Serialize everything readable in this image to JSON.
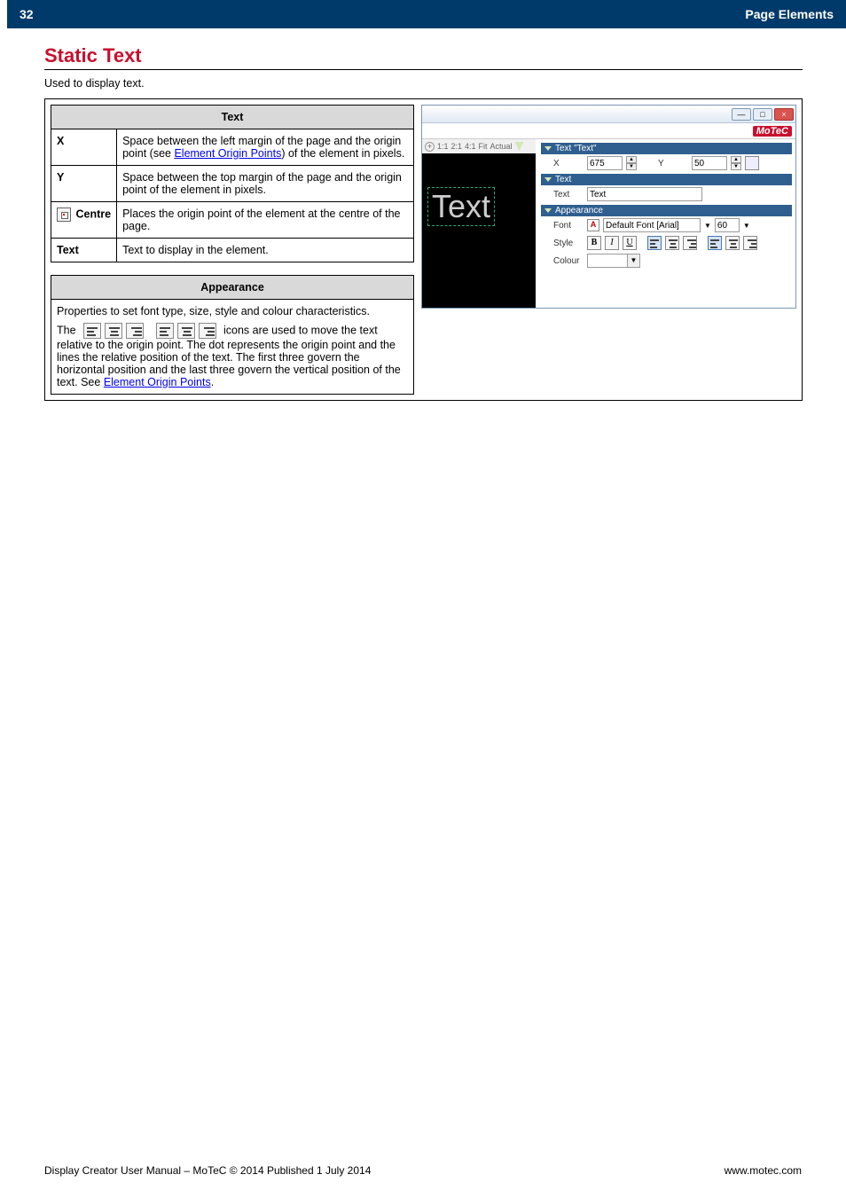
{
  "header": {
    "page_number": "32",
    "section": "Page Elements"
  },
  "section_title": "Static Text",
  "intro": "Used to display text.",
  "text_table": {
    "heading": "Text",
    "rows": [
      {
        "key": "X",
        "desc_a": "Space between the left margin of the page and the origin point (see ",
        "link": "Element Origin Points",
        "desc_b": ") of the element in pixels."
      },
      {
        "key": "Y",
        "desc_a": "Space between the top margin of the page and the origin point of the element in pixels.",
        "link": "",
        "desc_b": ""
      },
      {
        "key": "Centre",
        "desc_a": "Places the origin point of the element at the centre of the page.",
        "link": "",
        "desc_b": ""
      },
      {
        "key": "Text",
        "desc_a": "Text to display in the element.",
        "link": "",
        "desc_b": ""
      }
    ]
  },
  "appearance_table": {
    "heading": "Appearance",
    "para1": "Properties to set font type, size, style and colour characteristics.",
    "para2a": "The ",
    "para2b": " icons are used to move the text relative to the origin point. The dot represents the origin point and the lines the relative position of the text. The first three govern the horizontal position and the last three govern the vertical position of the text. See ",
    "para2_link": "Element Origin Points",
    "para2c": "."
  },
  "panel": {
    "brand": "MoTeC",
    "zoom": {
      "z11": "1:1",
      "z21": "2:1",
      "z41": "4:1",
      "fit": "Fit",
      "actual": "Actual"
    },
    "sections": {
      "pos_title": "Text \"Text\"",
      "x_label": "X",
      "x_value": "675",
      "y_label": "Y",
      "y_value": "50",
      "text_title": "Text",
      "text_label": "Text",
      "text_value": "Text",
      "app_title": "Appearance",
      "font_label": "Font",
      "font_name": "Default Font [Arial]",
      "font_size": "60",
      "style_label": "Style",
      "colour_label": "Colour"
    },
    "preview_text": "Text"
  },
  "footer": {
    "left": "Display Creator User Manual – MoTeC © 2014 Published 1 July 2014",
    "right": "www.motec.com"
  },
  "chart_data": {
    "type": "table",
    "note": "document page; no chart series"
  }
}
